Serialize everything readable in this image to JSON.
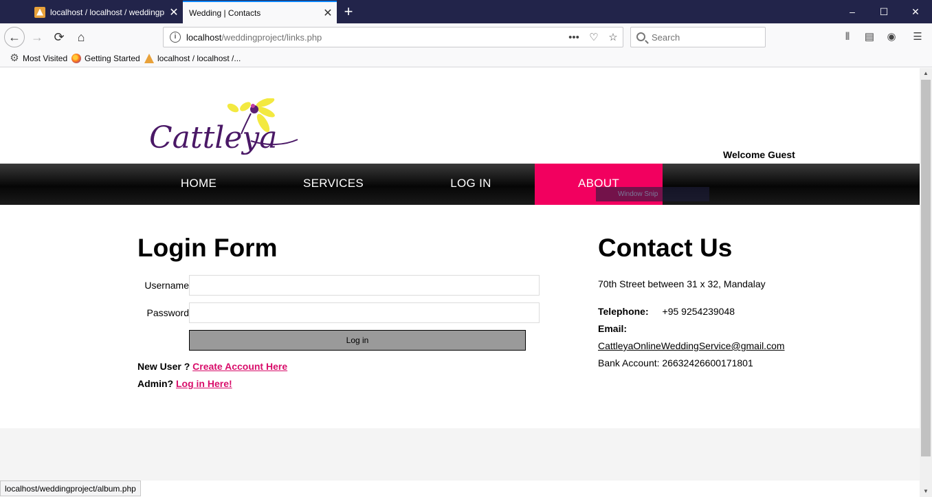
{
  "browser": {
    "tabs": [
      {
        "title": "localhost / localhost / weddingproj"
      },
      {
        "title": "Wedding | Contacts"
      }
    ],
    "new_tab": "+",
    "window_controls": {
      "minimize": "–",
      "maximize": "☐",
      "close": "✕"
    },
    "url": {
      "host": "localhost",
      "path": "/weddingproject/links.php"
    },
    "search": {
      "placeholder": "Search"
    },
    "bookmarks": [
      "Most Visited",
      "Getting Started",
      "localhost / localhost /..."
    ],
    "status_url": "localhost/weddingproject/album.php"
  },
  "site": {
    "logo_text": "Cattleya",
    "welcome": "Welcome Guest",
    "menu": [
      "HOME",
      "SERVICES",
      "LOG IN",
      "ABOUT"
    ],
    "active_menu": "ABOUT",
    "accent_color": "#f2005f",
    "overlay_text": "Window Snip"
  },
  "login": {
    "title": "Login Form",
    "username_label": "Username",
    "password_label": "Password",
    "submit": "Log in",
    "new_user_text": "New User ?",
    "create_link": "Create Account Here",
    "admin_text": "Admin?",
    "admin_link": "Log in Here!"
  },
  "contact": {
    "title": "Contact Us",
    "address": "70th Street between 31 x 32, Mandalay",
    "telephone_label": "Telephone:",
    "telephone": "+95 9254239048",
    "email_label": "Email:",
    "email": "CattleyaOnlineWeddingService@gmail.com",
    "bank_account": "Bank Account: 26632426600171801"
  }
}
